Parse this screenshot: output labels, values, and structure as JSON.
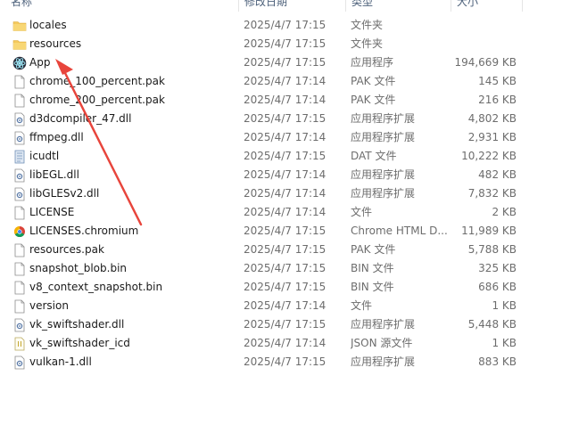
{
  "columns": {
    "name": "名称",
    "date": "修改日期",
    "type": "类型",
    "size": "大小"
  },
  "files": [
    {
      "name": "locales",
      "date": "2025/4/7 17:15",
      "type": "文件夹",
      "size": "",
      "icon": "folder-icon"
    },
    {
      "name": "resources",
      "date": "2025/4/7 17:15",
      "type": "文件夹",
      "size": "",
      "icon": "folder-icon"
    },
    {
      "name": "App",
      "date": "2025/4/7 17:15",
      "type": "应用程序",
      "size": "194,669 KB",
      "icon": "app-icon"
    },
    {
      "name": "chrome_100_percent.pak",
      "date": "2025/4/7 17:14",
      "type": "PAK 文件",
      "size": "145 KB",
      "icon": "file-icon"
    },
    {
      "name": "chrome_200_percent.pak",
      "date": "2025/4/7 17:14",
      "type": "PAK 文件",
      "size": "216 KB",
      "icon": "file-icon"
    },
    {
      "name": "d3dcompiler_47.dll",
      "date": "2025/4/7 17:15",
      "type": "应用程序扩展",
      "size": "4,802 KB",
      "icon": "dll-icon"
    },
    {
      "name": "ffmpeg.dll",
      "date": "2025/4/7 17:14",
      "type": "应用程序扩展",
      "size": "2,931 KB",
      "icon": "dll-icon"
    },
    {
      "name": "icudtl",
      "date": "2025/4/7 17:15",
      "type": "DAT 文件",
      "size": "10,222 KB",
      "icon": "dat-icon"
    },
    {
      "name": "libEGL.dll",
      "date": "2025/4/7 17:14",
      "type": "应用程序扩展",
      "size": "482 KB",
      "icon": "dll-icon"
    },
    {
      "name": "libGLESv2.dll",
      "date": "2025/4/7 17:14",
      "type": "应用程序扩展",
      "size": "7,832 KB",
      "icon": "dll-icon"
    },
    {
      "name": "LICENSE",
      "date": "2025/4/7 17:14",
      "type": "文件",
      "size": "2 KB",
      "icon": "file-icon"
    },
    {
      "name": "LICENSES.chromium",
      "date": "2025/4/7 17:15",
      "type": "Chrome HTML D...",
      "size": "11,989 KB",
      "icon": "chrome-icon"
    },
    {
      "name": "resources.pak",
      "date": "2025/4/7 17:15",
      "type": "PAK 文件",
      "size": "5,788 KB",
      "icon": "file-icon"
    },
    {
      "name": "snapshot_blob.bin",
      "date": "2025/4/7 17:15",
      "type": "BIN 文件",
      "size": "325 KB",
      "icon": "file-icon"
    },
    {
      "name": "v8_context_snapshot.bin",
      "date": "2025/4/7 17:15",
      "type": "BIN 文件",
      "size": "686 KB",
      "icon": "file-icon"
    },
    {
      "name": "version",
      "date": "2025/4/7 17:14",
      "type": "文件",
      "size": "1 KB",
      "icon": "file-icon"
    },
    {
      "name": "vk_swiftshader.dll",
      "date": "2025/4/7 17:15",
      "type": "应用程序扩展",
      "size": "5,448 KB",
      "icon": "dll-icon"
    },
    {
      "name": "vk_swiftshader_icd",
      "date": "2025/4/7 17:14",
      "type": "JSON 源文件",
      "size": "1 KB",
      "icon": "json-icon"
    },
    {
      "name": "vulkan-1.dll",
      "date": "2025/4/7 17:15",
      "type": "应用程序扩展",
      "size": "883 KB",
      "icon": "dll-icon"
    }
  ],
  "colors": {
    "folder": "#f4c95d",
    "arrow": "#e8453c",
    "header_text": "#4c607a"
  }
}
